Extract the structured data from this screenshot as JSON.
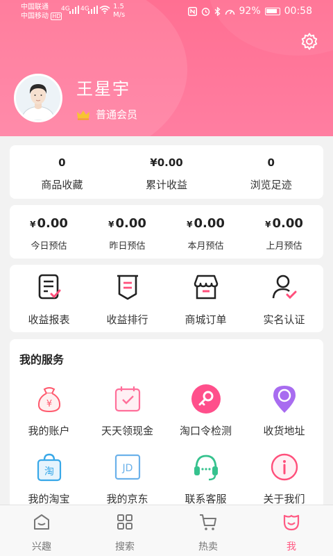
{
  "status_bar": {
    "carrier1": "中国联通",
    "carrier2": "中国移动",
    "hd": "HD",
    "net1": "4G",
    "net2": "4G",
    "speed_value": "1.5",
    "speed_unit": "M/s",
    "battery": "92%",
    "time": "00:58"
  },
  "profile": {
    "name": "王星宇",
    "membership": "普通会员"
  },
  "summary": [
    {
      "value": "0",
      "label": "商品收藏"
    },
    {
      "value": "¥0.00",
      "label": "累计收益"
    },
    {
      "value": "0",
      "label": "浏览足迹"
    }
  ],
  "estimates": [
    {
      "currency": "¥",
      "value": "0.00",
      "label": "今日预估"
    },
    {
      "currency": "¥",
      "value": "0.00",
      "label": "昨日预估"
    },
    {
      "currency": "¥",
      "value": "0.00",
      "label": "本月预估"
    },
    {
      "currency": "¥",
      "value": "0.00",
      "label": "上月预估"
    }
  ],
  "quick_actions": [
    {
      "label": "收益报表",
      "icon": "report-icon"
    },
    {
      "label": "收益排行",
      "icon": "ranking-icon"
    },
    {
      "label": "商城订单",
      "icon": "store-icon"
    },
    {
      "label": "实名认证",
      "icon": "verified-user-icon"
    }
  ],
  "services": {
    "title": "我的服务",
    "items": [
      {
        "label": "我的账户",
        "icon": "money-bag-icon"
      },
      {
        "label": "天天领现金",
        "icon": "calendar-check-icon"
      },
      {
        "label": "淘口令检测",
        "icon": "key-search-icon"
      },
      {
        "label": "收货地址",
        "icon": "location-pin-icon"
      },
      {
        "label": "我的淘宝",
        "icon": "taobao-bag-icon"
      },
      {
        "label": "我的京东",
        "icon": "jd-icon"
      },
      {
        "label": "联系客服",
        "icon": "headset-icon"
      },
      {
        "label": "关于我们",
        "icon": "info-icon"
      }
    ]
  },
  "tabs": [
    {
      "label": "兴趣",
      "icon": "interest-icon",
      "active": false
    },
    {
      "label": "搜索",
      "icon": "grid-icon",
      "active": false
    },
    {
      "label": "热卖",
      "icon": "cart-icon",
      "active": false
    },
    {
      "label": "我",
      "icon": "me-icon",
      "active": true
    }
  ],
  "colors": {
    "brand_pink": "#ff6f92",
    "active_tab": "#ff5a83",
    "background": "#f2f2f2"
  },
  "symbols": {
    "dagger": "🗡",
    "fire": "🔥"
  }
}
